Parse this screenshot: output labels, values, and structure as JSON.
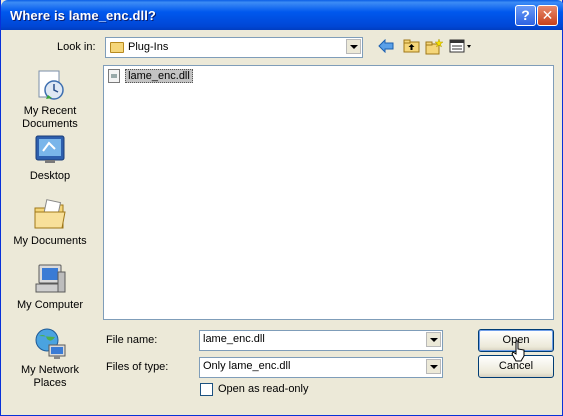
{
  "window": {
    "title": "Where is lame_enc.dll?"
  },
  "titlebar": {
    "help_glyph": "?",
    "close_glyph": "✕"
  },
  "lookin": {
    "label": "Look in:",
    "value": "Plug-Ins"
  },
  "places": [
    {
      "label": "My Recent Documents",
      "icon": "recent-documents-icon"
    },
    {
      "label": "Desktop",
      "icon": "desktop-icon"
    },
    {
      "label": "My Documents",
      "icon": "my-documents-icon"
    },
    {
      "label": "My Computer",
      "icon": "my-computer-icon"
    },
    {
      "label": "My Network Places",
      "icon": "network-places-icon"
    }
  ],
  "files": [
    {
      "name": "lame_enc.dll"
    }
  ],
  "filename": {
    "label": "File name:",
    "value": "lame_enc.dll"
  },
  "filetype": {
    "label": "Files of type:",
    "value": "Only lame_enc.dll"
  },
  "readonly": {
    "label": "Open as read-only",
    "checked": false
  },
  "buttons": {
    "open": "Open",
    "cancel": "Cancel"
  }
}
